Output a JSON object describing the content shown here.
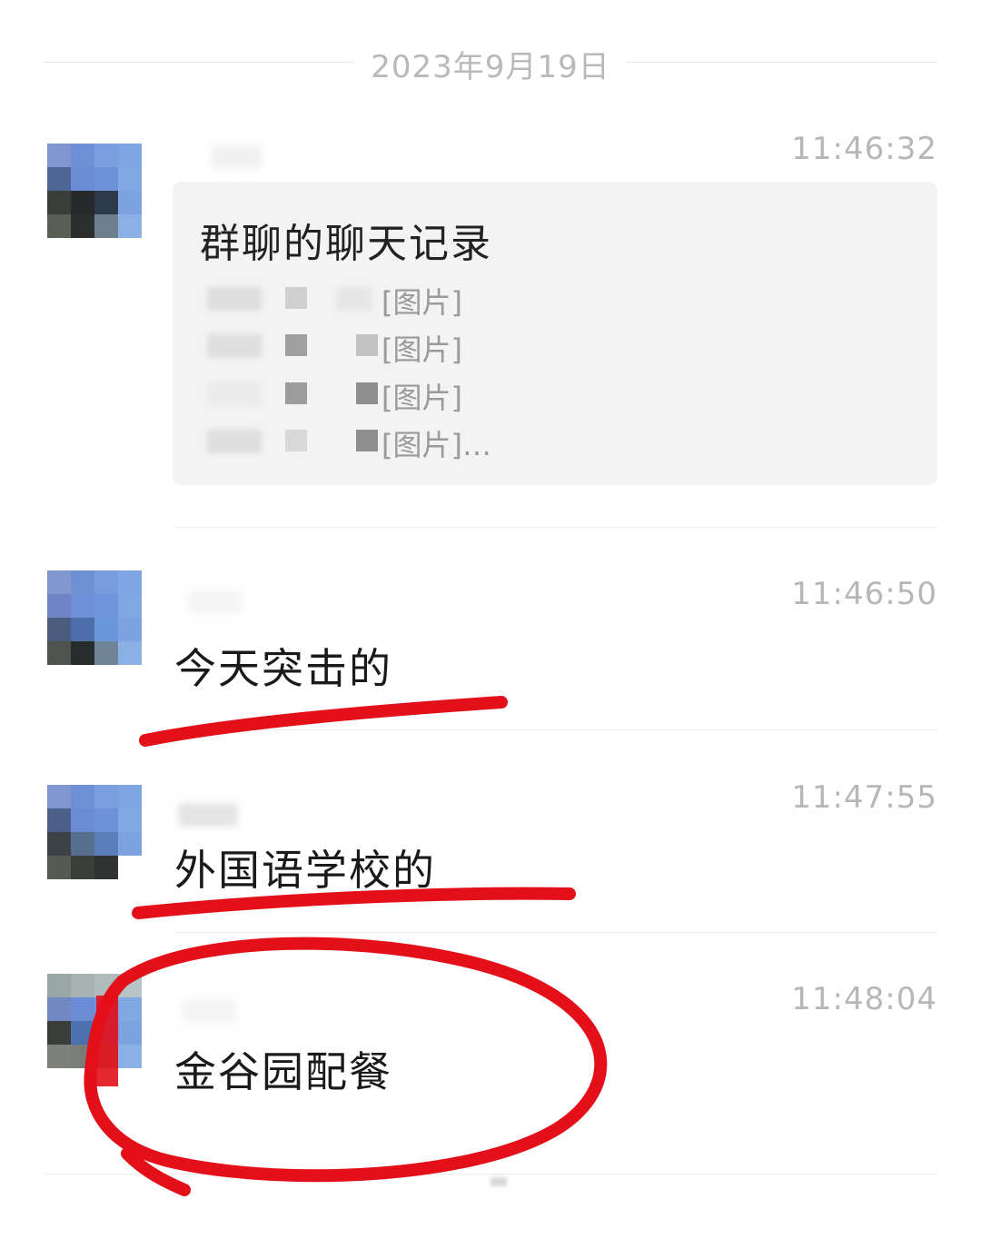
{
  "chat": {
    "date": "2023年9月19日",
    "messages": [
      {
        "time": "11:46:32",
        "card": {
          "title": "群聊的聊天记录",
          "lines": [
            "[图片]",
            "[图片]",
            "[图片]",
            "[图片]…"
          ]
        }
      },
      {
        "time": "11:46:50",
        "text": "今天突击的"
      },
      {
        "time": "11:47:55",
        "text": "外国语学校的"
      },
      {
        "time": "11:48:04",
        "text": "金谷园配餐"
      }
    ]
  },
  "annotations": {
    "color": "#e3101a"
  },
  "icons": {
    "avatar": "pixelated-avatar-icon"
  }
}
